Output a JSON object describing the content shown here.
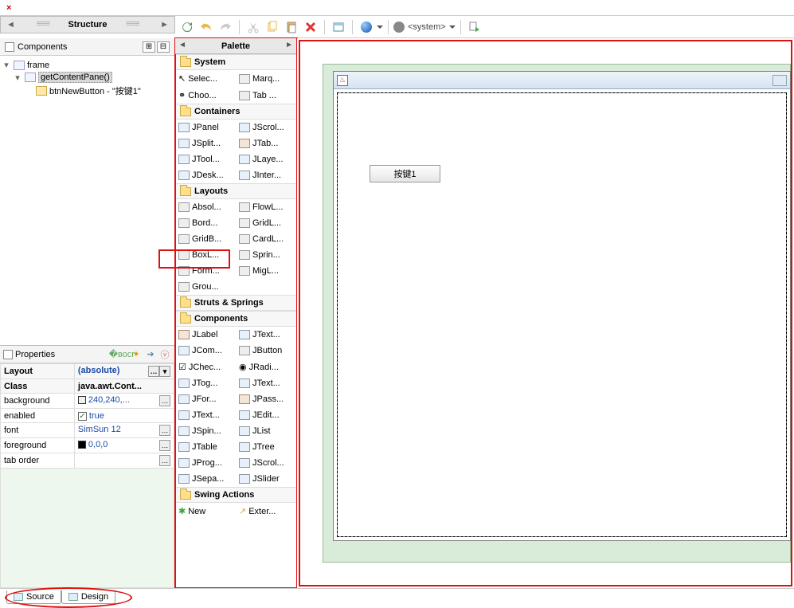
{
  "structure": {
    "title": "Structure",
    "components_label": "Components",
    "tree": {
      "frame": "frame",
      "content_pane": "getContentPane()",
      "btn": "btnNewButton - \"按键1\""
    }
  },
  "properties": {
    "title": "Properties",
    "rows": {
      "layout_k": "Layout",
      "layout_v": "(absolute)",
      "class_k": "Class",
      "class_v": "java.awt.Cont...",
      "background_k": "background",
      "background_v": "240,240,...",
      "enabled_k": "enabled",
      "enabled_v": "true",
      "font_k": "font",
      "font_v": "SimSun 12",
      "foreground_k": "foreground",
      "foreground_v": "0,0,0",
      "taborder_k": "tab order",
      "taborder_v": ""
    }
  },
  "toolbar": {
    "system_label": "<system>"
  },
  "palette": {
    "title": "Palette",
    "cat_system": "System",
    "sys": {
      "selection": "Selec...",
      "marquee": "Marq...",
      "choose": "Choo...",
      "tab": "Tab ..."
    },
    "cat_containers": "Containers",
    "cont": {
      "jpanel": "JPanel",
      "jscroll": "JScrol...",
      "jsplit": "JSplit...",
      "jtab": "JTab...",
      "jtool": "JTool...",
      "jlayer": "JLaye...",
      "jdesk": "JDesk...",
      "jinter": "JInter..."
    },
    "cat_layouts": "Layouts",
    "lay": {
      "absolute": "Absol...",
      "flow": "FlowL...",
      "border": "Bord...",
      "gridl": "GridL...",
      "gridb": "GridB...",
      "card": "CardL...",
      "boxl": "BoxL...",
      "spring": "Sprin...",
      "form": "Form...",
      "mig": "MigL...",
      "group": "Grou..."
    },
    "cat_struts": "Struts & Springs",
    "cat_components": "Components",
    "comp": {
      "jlabel": "JLabel",
      "jtext1": "JText...",
      "jcom": "JCom...",
      "jbutton": "JButton",
      "jcheck": "JChec...",
      "jradio": "JRadi...",
      "jtog": "JTog...",
      "jtext2": "JText...",
      "jfor": "JFor...",
      "jpass": "JPass...",
      "jtext3": "JText...",
      "jedit": "JEdit...",
      "jspin": "JSpin...",
      "jlist": "JList",
      "jtable": "JTable",
      "jtree": "JTree",
      "jprog": "JProg...",
      "jscroll": "JScrol...",
      "jsepa": "JSepa...",
      "jslider": "JSlider"
    },
    "cat_swing_actions": "Swing Actions",
    "sa": {
      "new": "New",
      "external": "Exter..."
    }
  },
  "designer": {
    "button_label": "按键1"
  },
  "bottom_tabs": {
    "source": "Source",
    "design": "Design"
  }
}
